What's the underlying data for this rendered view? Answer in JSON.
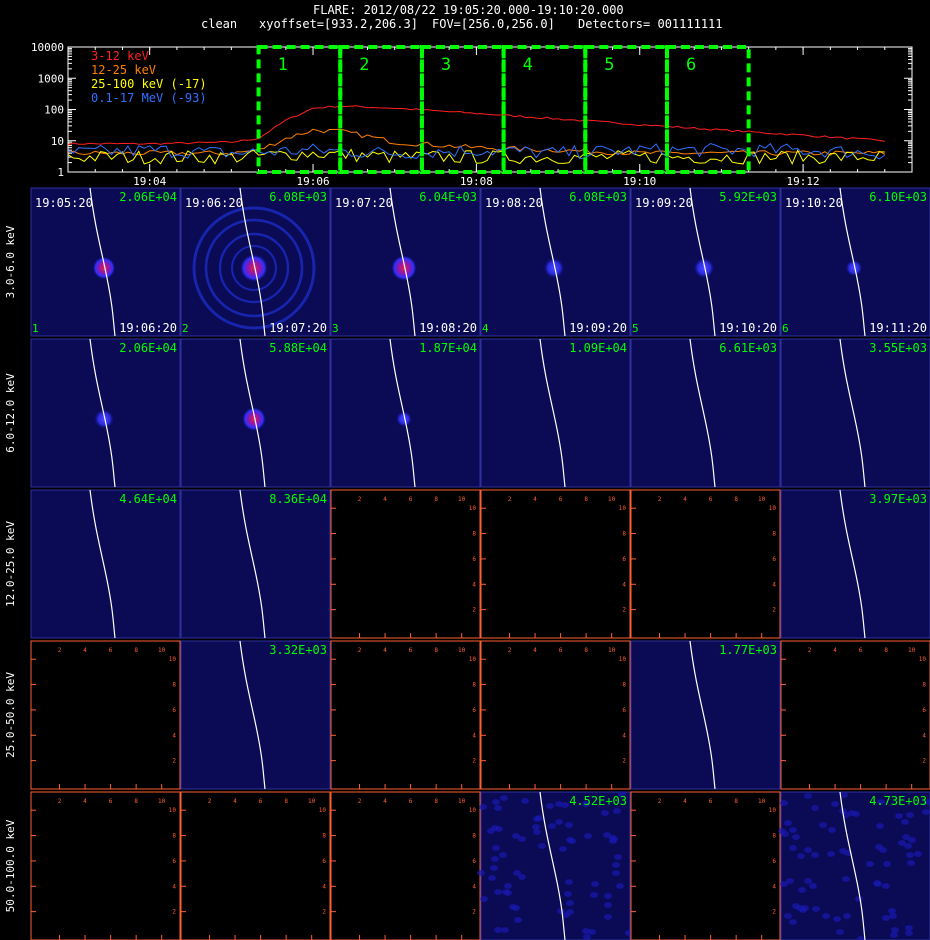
{
  "header": {
    "title": "FLARE: 2012/08/22 19:05:20.000-19:10:20.000",
    "method": "clean",
    "xyoffset": "xyoffset=[933.2,206.3]",
    "fov": "FOV=[256.0,256.0]",
    "detectors": "Detectors= 001111111"
  },
  "chart_data": [
    {
      "type": "line",
      "yscale": "log",
      "ylim": [
        1,
        10000
      ],
      "yticks": [
        "10000",
        "1000",
        "100",
        "10",
        "1"
      ],
      "xticks": [
        "19:04",
        "19:06",
        "19:08",
        "19:10",
        "19:12"
      ],
      "xlim": [
        "19:03:00",
        "19:13:20"
      ],
      "series": [
        {
          "name": "3-12 keV",
          "color": "#ff2020",
          "x": [
            "19:03:00",
            "19:04:00",
            "19:05:00",
            "19:05:20",
            "19:05:40",
            "19:06:00",
            "19:06:20",
            "19:07:00",
            "19:08:00",
            "19:09:00",
            "19:10:00",
            "19:11:00",
            "19:12:00",
            "19:13:00"
          ],
          "values": [
            8,
            8,
            9,
            12,
            45,
            110,
            130,
            110,
            75,
            50,
            33,
            22,
            15,
            10
          ]
        },
        {
          "name": "12-25 keV",
          "color": "#ff8000",
          "x": [
            "19:03:00",
            "19:04:00",
            "19:05:00",
            "19:05:20",
            "19:05:40",
            "19:06:00",
            "19:06:20",
            "19:06:40",
            "19:07:00",
            "19:08:00",
            "19:09:00",
            "19:10:00",
            "19:11:00",
            "19:12:00",
            "19:13:00"
          ],
          "values": [
            4,
            4,
            4,
            5,
            12,
            22,
            20,
            14,
            9,
            6,
            5,
            4,
            4,
            4,
            4
          ]
        },
        {
          "name": "25-100 keV (-17)",
          "color": "#ffff00",
          "x": [
            "19:03:00",
            "19:04:00",
            "19:05:00",
            "19:06:00",
            "19:07:00",
            "19:08:00",
            "19:09:00",
            "19:10:00",
            "19:11:00",
            "19:12:00",
            "19:13:00"
          ],
          "values": [
            3,
            3,
            3,
            4,
            3,
            3,
            3,
            3,
            3,
            3,
            3
          ]
        },
        {
          "name": "0.1-17 MeV (-93)",
          "color": "#3070ff",
          "x": [
            "19:03:00",
            "19:04:00",
            "19:05:00",
            "19:06:00",
            "19:07:00",
            "19:08:00",
            "19:09:00",
            "19:10:00",
            "19:11:00",
            "19:12:00",
            "19:13:00"
          ],
          "values": [
            4,
            5,
            4,
            5,
            4,
            5,
            4,
            5,
            5,
            5,
            4
          ]
        }
      ],
      "intervals": [
        {
          "label": "1",
          "start": "19:05:20",
          "end": "19:06:20"
        },
        {
          "label": "2",
          "start": "19:06:20",
          "end": "19:07:20"
        },
        {
          "label": "3",
          "start": "19:07:20",
          "end": "19:08:20"
        },
        {
          "label": "4",
          "start": "19:08:20",
          "end": "19:09:20"
        },
        {
          "label": "5",
          "start": "19:09:20",
          "end": "19:10:20"
        },
        {
          "label": "6",
          "start": "19:10:20",
          "end": "19:11:20"
        }
      ],
      "interval_color": "#00ff00"
    },
    {
      "type": "heatmap",
      "energy_bands": [
        "3.0-6.0 keV",
        "6.0-12.0 keV",
        "12.0-25.0 keV",
        "25.0-50.0 keV",
        "50.0-100.0 keV"
      ],
      "column_labels": [
        "1",
        "2",
        "3",
        "4",
        "5",
        "6"
      ],
      "start_times": [
        "19:05:20",
        "19:06:20",
        "19:07:20",
        "19:08:20",
        "19:09:20",
        "19:10:20"
      ],
      "end_times": [
        "19:06:20",
        "19:07:20",
        "19:08:20",
        "19:09:20",
        "19:10:20",
        "19:11:20"
      ],
      "axis_ticks": [
        "2",
        "4",
        "6",
        "8",
        "10"
      ],
      "rows": [
        [
          {
            "kind": "image",
            "max": "2.06E+04",
            "level": 0.55
          },
          {
            "kind": "image",
            "max": "6.08E+03",
            "level": 0.8,
            "rings": true
          },
          {
            "kind": "image",
            "max": "6.04E+03",
            "level": 0.7
          },
          {
            "kind": "image",
            "max": "6.08E+03",
            "level": 0.45
          },
          {
            "kind": "image",
            "max": "5.92E+03",
            "level": 0.45
          },
          {
            "kind": "image",
            "max": "6.10E+03",
            "level": 0.25
          }
        ],
        [
          {
            "kind": "image",
            "max": "2.06E+04",
            "level": 0.4
          },
          {
            "kind": "image",
            "max": "5.88E+04",
            "level": 0.6
          },
          {
            "kind": "image",
            "max": "1.87E+04",
            "level": 0.2
          },
          {
            "kind": "image",
            "max": "1.09E+04",
            "level": 0
          },
          {
            "kind": "image",
            "max": "6.61E+03",
            "level": 0
          },
          {
            "kind": "image",
            "max": "3.55E+03",
            "level": 0
          }
        ],
        [
          {
            "kind": "image",
            "max": "4.64E+04",
            "level": 0
          },
          {
            "kind": "image",
            "max": "8.36E+04",
            "level": 0
          },
          {
            "kind": "empty"
          },
          {
            "kind": "empty"
          },
          {
            "kind": "empty"
          },
          {
            "kind": "image",
            "max": "3.97E+03",
            "level": 0
          }
        ],
        [
          {
            "kind": "empty"
          },
          {
            "kind": "image",
            "max": "3.32E+03",
            "level": 0
          },
          {
            "kind": "empty"
          },
          {
            "kind": "empty"
          },
          {
            "kind": "image",
            "max": "1.77E+03",
            "level": 0
          },
          {
            "kind": "empty"
          }
        ],
        [
          {
            "kind": "empty"
          },
          {
            "kind": "empty"
          },
          {
            "kind": "empty"
          },
          {
            "kind": "image",
            "max": "4.52E+03",
            "level": 0,
            "noise": true
          },
          {
            "kind": "empty"
          },
          {
            "kind": "image",
            "max": "4.73E+03",
            "level": 0,
            "noise": true
          }
        ]
      ]
    }
  ]
}
